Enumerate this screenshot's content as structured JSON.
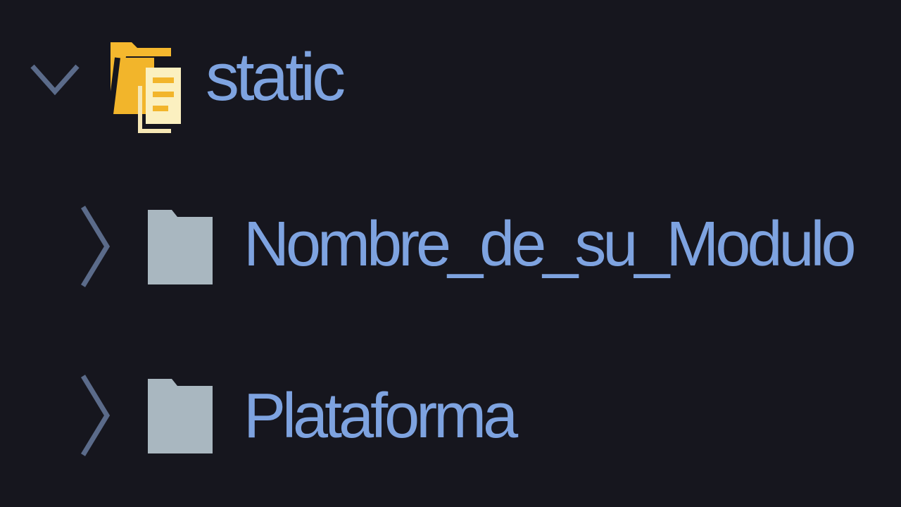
{
  "explorer": {
    "items": [
      {
        "label": "static",
        "expanded": true,
        "icon": "folder-open-static-icon"
      },
      {
        "label": "Nombre_de_su_Modulo",
        "expanded": false,
        "icon": "folder-icon"
      },
      {
        "label": "Plataforma",
        "expanded": false,
        "icon": "folder-icon"
      }
    ]
  },
  "colors": {
    "background": "#16161e",
    "text": "#7ea3e0",
    "folder": "#f5b82e",
    "folder_closed": "#a9b7c0"
  }
}
